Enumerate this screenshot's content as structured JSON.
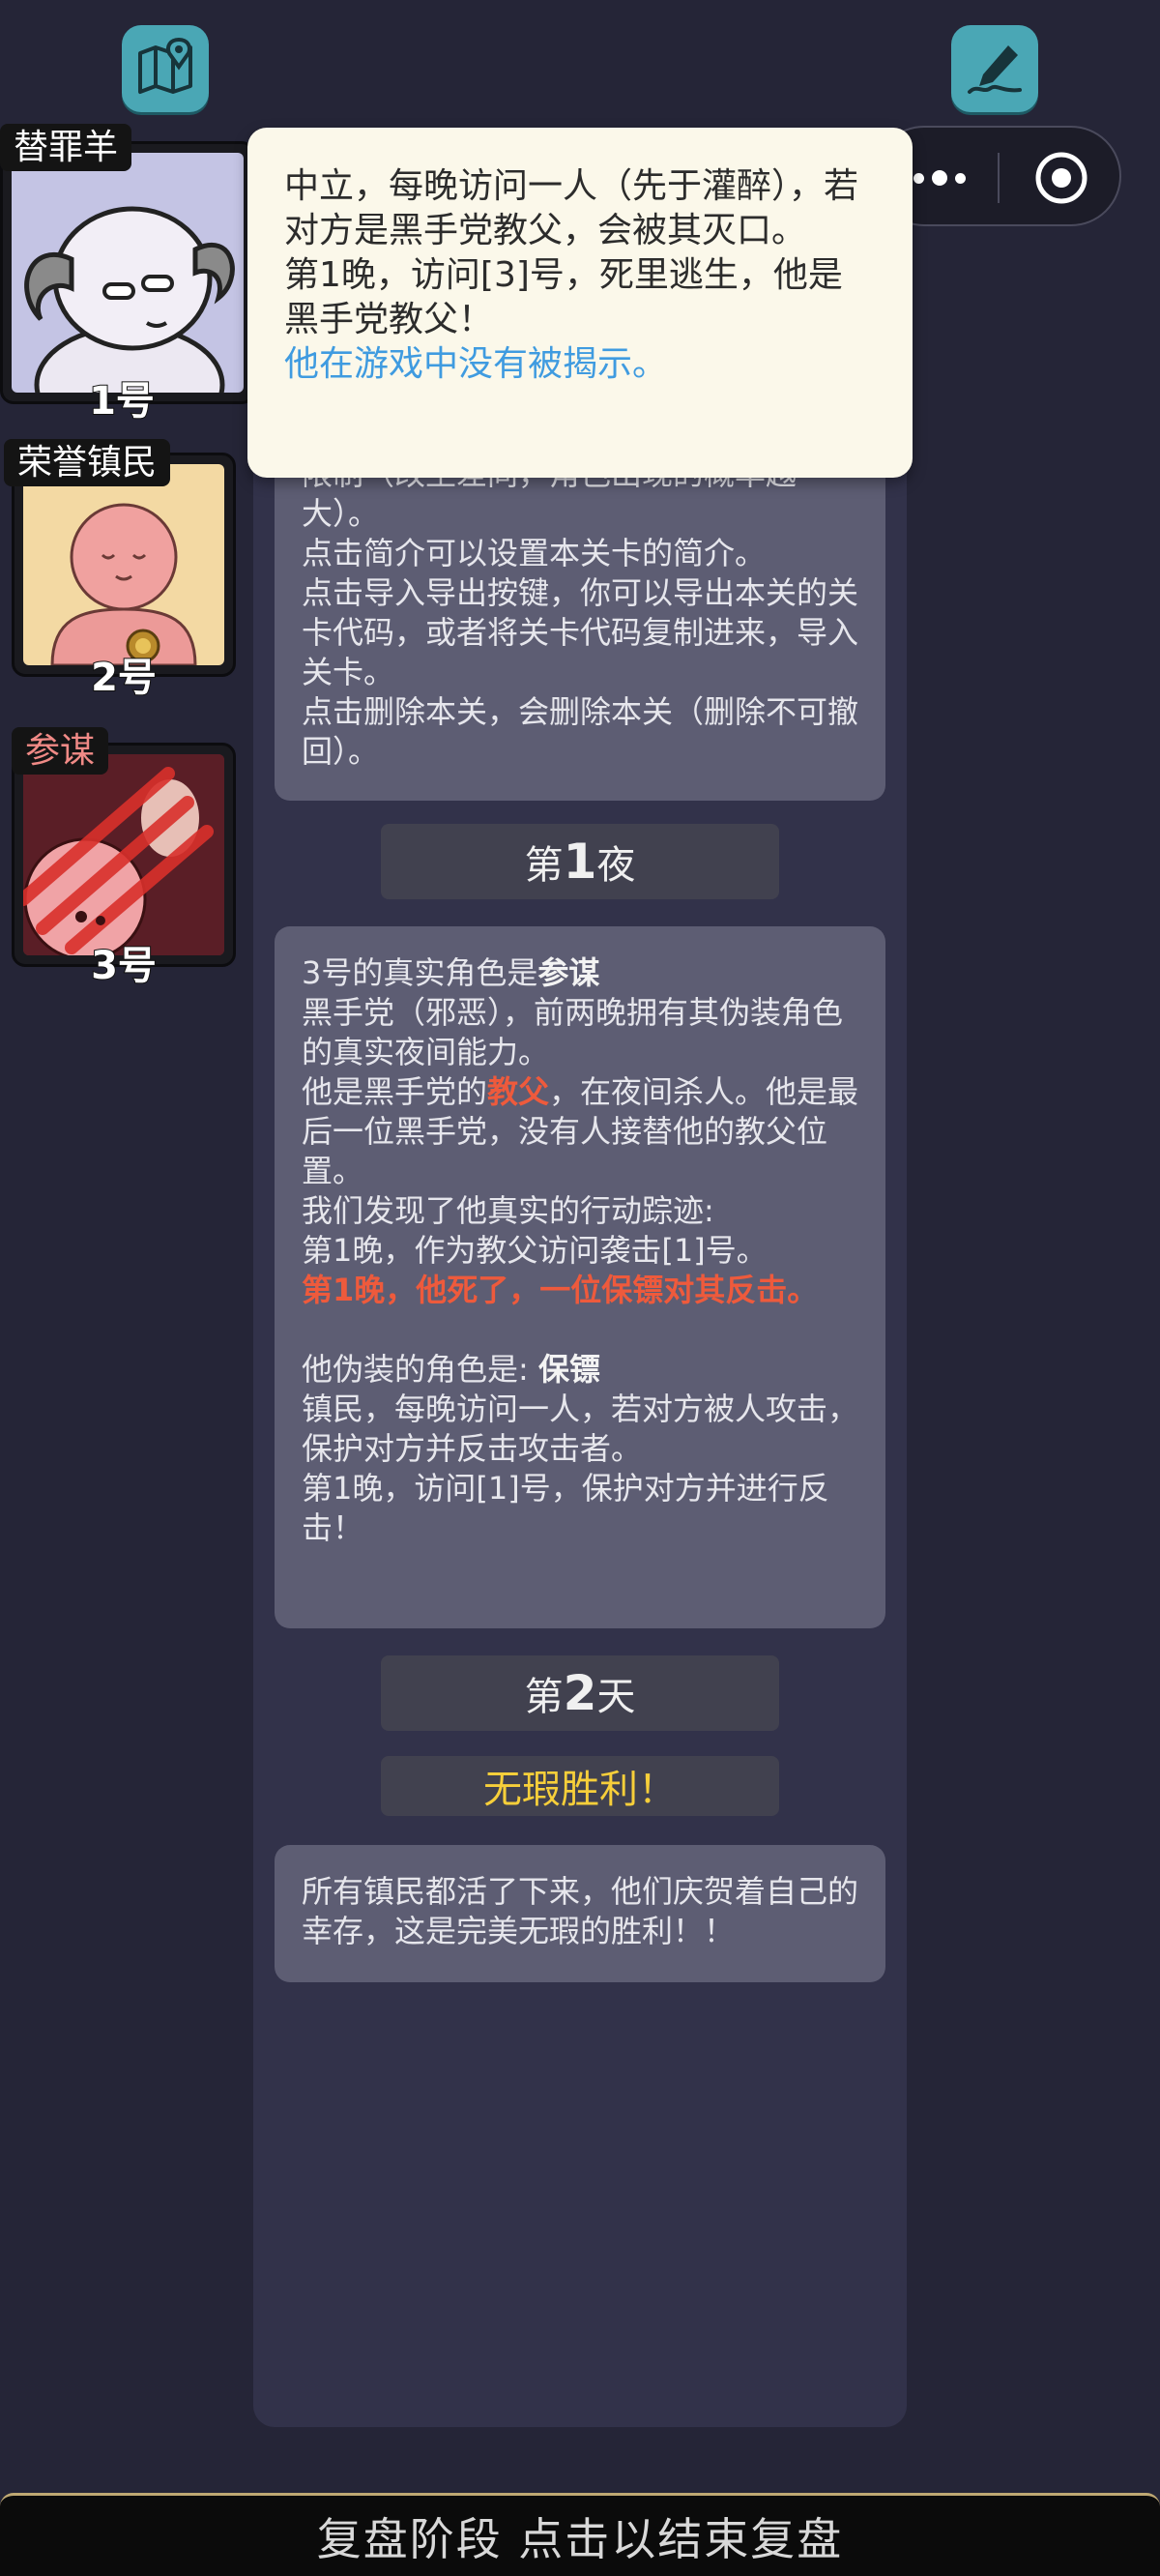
{
  "top_buttons": {
    "map_icon": "map-pin-icon",
    "edit_icon": "pen-sign-icon"
  },
  "capsule": {
    "more_icon": "more-dots-icon",
    "close_icon": "target-close-icon"
  },
  "players": [
    {
      "role": "替罪羊",
      "number": "1号",
      "portrait": "scapegoat-portrait"
    },
    {
      "role": "荣誉镇民",
      "number": "2号",
      "portrait": "honorary-townsman-portrait"
    },
    {
      "role": "参谋",
      "number": "3号",
      "portrait": "consigliere-portrait"
    }
  ],
  "tooltip": {
    "line1": "中立，每晚访问一人（先于灌醉），若对方是黑手党教父，会被其灭口。",
    "line2": "第1晚，访问[3]号，死里逃生，他是黑手党教父！",
    "line3": "他在游戏中没有被揭示。"
  },
  "intro_message": {
    "partial": "限制（改坐差同，角色出现的概率越大）。",
    "line1": "点击简介可以设置本关卡的简介。",
    "line2": "点击导入导出按键，你可以导出本关的关卡代码，或者将关卡代码复制进来，导入关卡。",
    "line3": "点击删除本关，会删除本关（删除不可撤回）。"
  },
  "night1": {
    "pre": "第",
    "num": "1",
    "post": "夜"
  },
  "night1_message": {
    "l1_pre": "3号的真实角色是",
    "l1_role": "参谋",
    "l2": "黑手党（邪恶），前两晚拥有其伪装角色的真实夜间能力。",
    "l3_pre": "他是黑手党的",
    "l3_role": "教父",
    "l3_post": "，在夜间杀人。他是最后一位黑手党，没有人接替他的教父位置。",
    "l4": "我们发现了他真实的行动踪迹:",
    "l5": "第1晚，作为教父访问袭击[1]号。",
    "l6": "第1晚，他死了，一位保镖对其反击。",
    "l7_pre": "他伪装的角色是: ",
    "l7_role": "保镖",
    "l8": "镇民，每晚访问一人，若对方被人攻击，保护对方并反击攻击者。",
    "l9": "第1晚，访问[1]号，保护对方并进行反击！"
  },
  "day2": {
    "pre": "第",
    "num": "2",
    "post": "天"
  },
  "victory": {
    "label": "无瑕胜利！"
  },
  "victory_message": {
    "text": "所有镇民都活了下来，他们庆贺着自己的幸存，这是完美无瑕的胜利！！"
  },
  "bottom_bar": {
    "label": "复盘阶段 点击以结束复盘"
  }
}
